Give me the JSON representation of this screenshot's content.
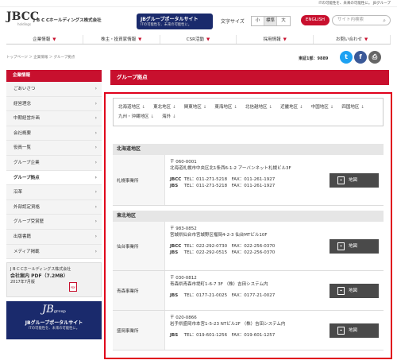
{
  "top_tagline": "ITの可能性を、未来の可能性に。 JBグループ",
  "header": {
    "logo_main": "JBCC",
    "logo_sub": "holdings",
    "company_name": "J B C Cホールディングス株式会社",
    "portal_title": "JBグループポータルサイト",
    "portal_sub": "ITの可能性を、未来の可能性に。",
    "font_size_label": "文字サイズ",
    "font_sizes": [
      "小",
      "標準",
      "大"
    ],
    "english_label": "ENGLISH",
    "search_placeholder": "サイト内検索",
    "search_icon": "search-icon"
  },
  "global_nav": [
    {
      "label": "企業情報"
    },
    {
      "label": "株主・投資家情報"
    },
    {
      "label": "CSR活動"
    },
    {
      "label": "採用情報"
    },
    {
      "label": "お問い合わせ"
    }
  ],
  "breadcrumb": "トップページ ＞ 企業情報 ＞ グループ拠点",
  "count_label": "東証1部：9889",
  "social": [
    "t",
    "f",
    "⎙"
  ],
  "sidebar": {
    "heading": "企業情報",
    "items": [
      {
        "label": "ごあいさつ"
      },
      {
        "label": "経営理念"
      },
      {
        "label": "中期経営計画"
      },
      {
        "label": "会社概要"
      },
      {
        "label": "役員一覧"
      },
      {
        "label": "グループ企業"
      },
      {
        "label": "グループ拠点"
      },
      {
        "label": "沿革"
      },
      {
        "label": "外部認定資格"
      },
      {
        "label": "グループ受賞歴"
      },
      {
        "label": "出版書籍"
      },
      {
        "label": "メディア掲載"
      }
    ],
    "pdf_line1": "J B C Cホールディングス株式会社",
    "pdf_line2": "会社案内 PDF（7.2MB）",
    "pdf_line3": "2017年7月版",
    "pdf_icon": "PDF",
    "portal_logo": "JB",
    "portal_logo_small": "group",
    "portal_title": "JBグループポータルサイト",
    "portal_sub": "ITの可能性を、未来の可能性に。"
  },
  "page_title": "グループ拠点",
  "region_links": [
    {
      "label": "北海道地区"
    },
    {
      "label": "東北地区"
    },
    {
      "label": "関東地区"
    },
    {
      "label": "東海地区"
    },
    {
      "label": "北信越地区"
    },
    {
      "label": "近畿地区"
    },
    {
      "label": "中国地区"
    },
    {
      "label": "四国地区"
    },
    {
      "label": "九州・沖縄地区"
    },
    {
      "label": "海外"
    }
  ],
  "region_link_arrow": "↓",
  "map_label": "地図",
  "regions": [
    {
      "name": "北海道地区",
      "offices": [
        {
          "name": "札幌事業所",
          "postal": "〒 060-0001",
          "address": "北海道札幌市中央区北1条西6-1-2 アーバンネット札幌ビル3F",
          "lines": [
            {
              "co": "JBCC",
              "text": "TEL：011-271-5218　FAX：011-261-1927"
            },
            {
              "co": "JBS",
              "text": "TEL：011-271-5218　FAX：011-261-1927"
            }
          ]
        }
      ]
    },
    {
      "name": "東北地区",
      "offices": [
        {
          "name": "仙台事業所",
          "postal": "〒 983-0852",
          "address": "宮城県仙台市宮城野区榴岡4-2-3 仙台MTビル10F",
          "lines": [
            {
              "co": "JBCC",
              "text": "TEL：022-292-0730　FAX：022-256-0370"
            },
            {
              "co": "JBS",
              "text": "TEL：022-292-0515　FAX：022-256-0370"
            }
          ]
        },
        {
          "name": "青森事業所",
          "postal": "〒 030-0812",
          "address": "青森県青森市堤町1-6-7 3F （株）吉田システム内",
          "lines": [
            {
              "co": "JBS",
              "text": "TEL：0177-21-0025　FAX：0177-21-0027"
            }
          ]
        },
        {
          "name": "盛岡事業所",
          "postal": "〒 020-0866",
          "address": "岩手県盛岡市本宮1-5-23 NTビル2F （株）吉田システム内",
          "lines": [
            {
              "co": "JBS",
              "text": "TEL：019-601-1256　FAX：019-601-1257"
            }
          ]
        }
      ]
    }
  ]
}
